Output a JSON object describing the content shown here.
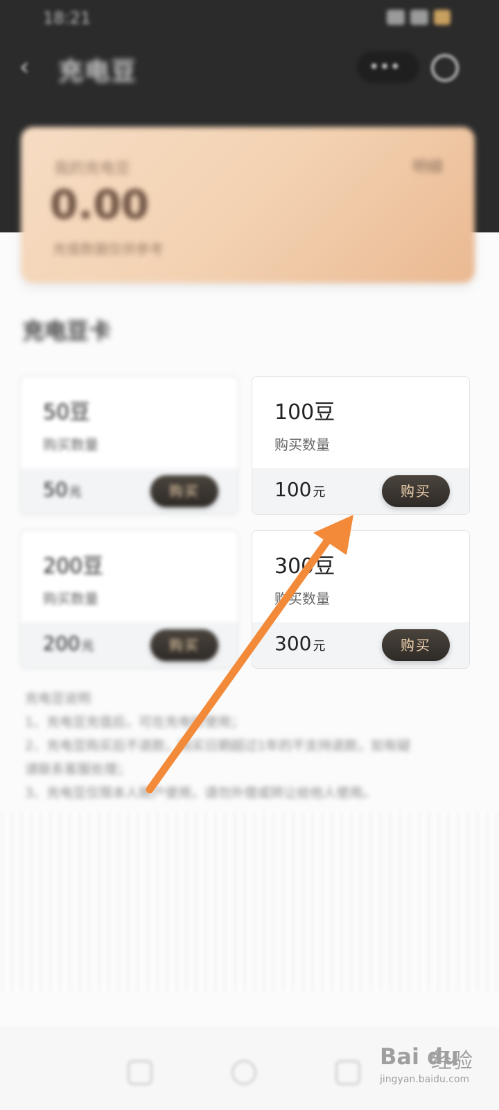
{
  "status_bar": {
    "time": "18:21"
  },
  "header": {
    "title": "充电豆",
    "capsule_dots": "•••"
  },
  "balance": {
    "label": "我的充电豆",
    "link": "明细",
    "value": "0.00",
    "note": "充值数据仅供参考"
  },
  "section_title": "充电豆卡",
  "cards": [
    {
      "bean": "50豆",
      "qty_label": "购买数量",
      "price": "50",
      "unit": "元",
      "buy": "购买"
    },
    {
      "bean": "100豆",
      "qty_label": "购买数量",
      "price": "100",
      "unit": "元",
      "buy": "购买"
    },
    {
      "bean": "200豆",
      "qty_label": "购买数量",
      "price": "200",
      "unit": "元",
      "buy": "购买"
    },
    {
      "bean": "300豆",
      "qty_label": "购买数量",
      "price": "300",
      "unit": "元",
      "buy": "购买"
    }
  ],
  "rules": {
    "title": "充电豆说明",
    "line1": "1、充电豆充值后，可在充电时使用；",
    "line2": "2、充电豆购买后不退款，购买日期超过1年的不支持退款，如有疑",
    "line3": "请联系客服处理；",
    "line4": "3、充电豆仅限本人账户使用，请勿外借或转让给他人使用。"
  },
  "watermark": {
    "logo": "Bai du",
    "text": "经验",
    "url": "jingyan.baidu.com"
  },
  "colors": {
    "header_bg": "#2b2b2b",
    "card_gradient_start": "#f6dcc4",
    "card_gradient_end": "#eab992",
    "buy_button": "#3a352f",
    "buy_text": "#f0d2ae",
    "arrow": "#f28a3a"
  }
}
